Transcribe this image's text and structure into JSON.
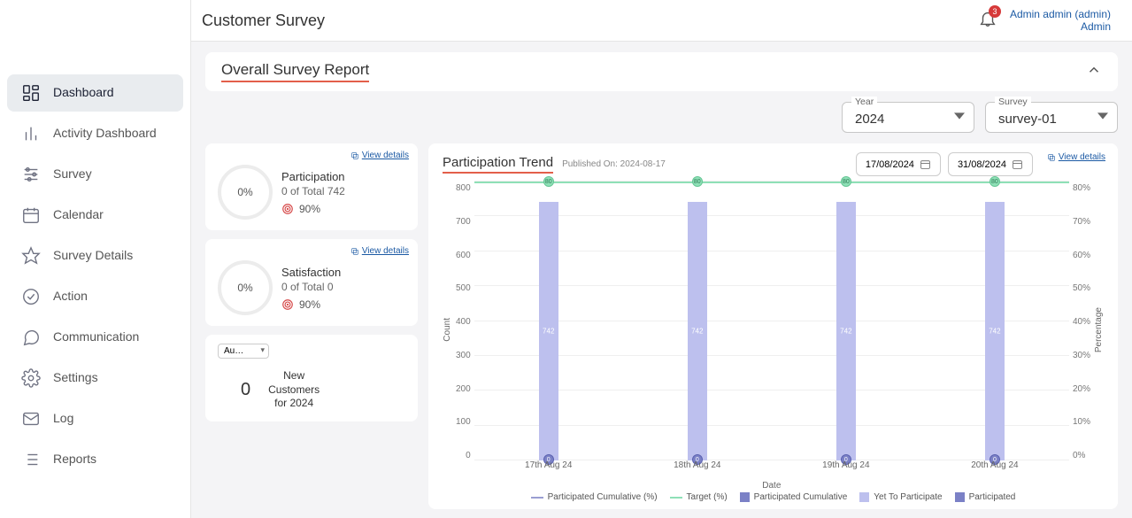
{
  "sidebar": {
    "items": [
      {
        "label": "Dashboard"
      },
      {
        "label": "Activity Dashboard"
      },
      {
        "label": "Survey"
      },
      {
        "label": "Calendar"
      },
      {
        "label": "Survey Details"
      },
      {
        "label": "Action"
      },
      {
        "label": "Communication"
      },
      {
        "label": "Settings"
      },
      {
        "label": "Log"
      },
      {
        "label": "Reports"
      }
    ]
  },
  "topbar": {
    "title": "Customer Survey",
    "notif_count": "3",
    "user_name": "Admin admin (admin)",
    "user_role": "Admin"
  },
  "section": {
    "title": "Overall Survey Report"
  },
  "filters": {
    "year_label": "Year",
    "year_value": "2024",
    "survey_label": "Survey",
    "survey_value": "survey-01"
  },
  "participation_card": {
    "view_details": "View details",
    "pct": "0%",
    "title": "Participation",
    "sub": "0 of Total 742",
    "target": "90%"
  },
  "satisfaction_card": {
    "view_details": "View details",
    "pct": "0%",
    "title": "Satisfaction",
    "sub": "0 of Total 0",
    "target": "90%"
  },
  "customers_card": {
    "selector": "Au…",
    "value": "0",
    "label_l1": "New",
    "label_l2": "Customers",
    "label_l3": "for 2024"
  },
  "trend": {
    "title": "Participation Trend",
    "published": "Published On: 2024-08-17",
    "date_from": "17/08/2024",
    "date_to": "31/08/2024",
    "view_details": "View details",
    "y1_label": "Count",
    "y2_label": "Percentage",
    "x_label": "Date",
    "y1_ticks": [
      "800",
      "700",
      "600",
      "500",
      "400",
      "300",
      "200",
      "100",
      "0"
    ],
    "y2_ticks": [
      "80%",
      "70%",
      "60%",
      "50%",
      "40%",
      "30%",
      "20%",
      "10%",
      "0%"
    ],
    "categories": [
      "17th Aug 24",
      "18th Aug 24",
      "19th Aug 24",
      "20th Aug 24"
    ],
    "legend": {
      "partic_cum_pct": "Participated Cumulative (%)",
      "target_pct": "Target (%)",
      "partic_cum": "Participated Cumulative",
      "yet": "Yet To Participate",
      "participated": "Participated"
    },
    "bar_value": "742",
    "bottom_value": "0",
    "target_value": "80"
  },
  "chart_data": {
    "type": "bar",
    "title": "Participation Trend",
    "xlabel": "Date",
    "ylabel": "Count",
    "y2label": "Percentage",
    "ylim": [
      0,
      800
    ],
    "y2lim": [
      0,
      80
    ],
    "categories": [
      "17th Aug 24",
      "18th Aug 24",
      "19th Aug 24",
      "20th Aug 24"
    ],
    "series": [
      {
        "name": "Yet To Participate",
        "type": "bar",
        "values": [
          742,
          742,
          742,
          742
        ]
      },
      {
        "name": "Participated",
        "type": "bar",
        "values": [
          0,
          0,
          0,
          0
        ]
      },
      {
        "name": "Participated Cumulative",
        "type": "bar",
        "values": [
          0,
          0,
          0,
          0
        ]
      },
      {
        "name": "Participated Cumulative (%)",
        "type": "line",
        "axis": "y2",
        "values": [
          0,
          0,
          0,
          0
        ]
      },
      {
        "name": "Target (%)",
        "type": "line",
        "axis": "y2",
        "values": [
          80,
          80,
          80,
          80
        ]
      }
    ]
  }
}
